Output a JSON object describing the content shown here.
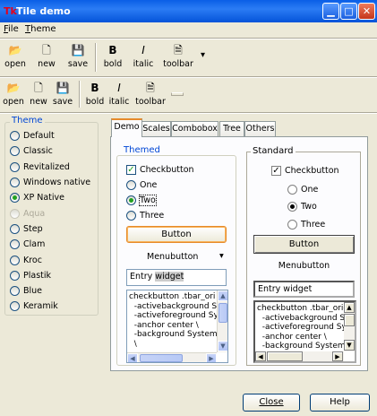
{
  "window": {
    "title": "Tile demo"
  },
  "menubar": [
    {
      "label": "File",
      "accel": "F",
      "rest": "ile"
    },
    {
      "label": "Theme",
      "accel": "T",
      "rest": "heme"
    }
  ],
  "toolbar1": {
    "buttons": [
      {
        "label": "open",
        "icon": "open-folder-icon"
      },
      {
        "label": "new",
        "icon": "new-file-icon"
      },
      {
        "label": "save",
        "icon": "save-icon"
      },
      {
        "label": "bold",
        "icon": "bold-icon",
        "glyph": "B"
      },
      {
        "label": "italic",
        "icon": "italic-icon",
        "glyph": "I"
      },
      {
        "label": "toolbar",
        "icon": "toolbar-icon"
      }
    ],
    "menu_glyph": "▾"
  },
  "toolbar2": {
    "buttons": [
      {
        "label": "open",
        "icon": "open-folder-icon"
      },
      {
        "label": "new",
        "icon": "new-file-icon"
      },
      {
        "label": "save",
        "icon": "save-icon"
      },
      {
        "label": "bold",
        "icon": "bold-icon",
        "glyph": "B"
      },
      {
        "label": "italic",
        "icon": "italic-icon",
        "glyph": "I"
      },
      {
        "label": "toolbar",
        "icon": "toolbar-icon"
      }
    ]
  },
  "theme_frame": {
    "label": "Theme",
    "options": [
      {
        "label": "Default",
        "selected": false,
        "disabled": false
      },
      {
        "label": "Classic",
        "selected": false,
        "disabled": false
      },
      {
        "label": "Revitalized",
        "selected": false,
        "disabled": false
      },
      {
        "label": "Windows native",
        "selected": false,
        "disabled": false
      },
      {
        "label": "XP Native",
        "selected": true,
        "disabled": false
      },
      {
        "label": "Aqua",
        "selected": false,
        "disabled": true
      },
      {
        "label": "Step",
        "selected": false,
        "disabled": false
      },
      {
        "label": "Clam",
        "selected": false,
        "disabled": false
      },
      {
        "label": "Kroc",
        "selected": false,
        "disabled": false
      },
      {
        "label": "Plastik",
        "selected": false,
        "disabled": false
      },
      {
        "label": "Blue",
        "selected": false,
        "disabled": false
      },
      {
        "label": "Keramik",
        "selected": false,
        "disabled": false
      }
    ]
  },
  "notebook": {
    "tabs": [
      "Demo",
      "Scales",
      "Combobox",
      "Tree",
      "Others"
    ],
    "active_tab": "Demo"
  },
  "themed": {
    "label": "Themed",
    "checkbutton": "Checkbutton",
    "checked": true,
    "radios": [
      "One",
      "Two",
      "Three"
    ],
    "selected_radio": "Two",
    "button": "Button",
    "menubutton": "Menubutton",
    "entry_value_pre": "Entry ",
    "entry_value_sel": "widget",
    "text_lines": [
      "checkbutton .tbar_ori",
      "  -activebackground S",
      "  -activeforeground Sy",
      "  -anchor center \\",
      "  -background System",
      "  \\"
    ]
  },
  "standard": {
    "label": "Standard",
    "checkbutton": "Checkbutton",
    "checked": true,
    "radios": [
      "One",
      "Two",
      "Three"
    ],
    "selected_radio": "Two",
    "button": "Button",
    "menubutton": "Menubutton",
    "entry_value": "Entry widget",
    "text_lines": [
      "checkbutton .tbar_orig",
      "  -activebackground S",
      "  -activeforeground Sy",
      "  -anchor center \\",
      "  -background System"
    ]
  },
  "footer": {
    "close": "Close",
    "help": "Help"
  },
  "colors": {
    "titlebar": "#0a5fe6",
    "window_bg": "#ece9d8",
    "tab_active_accent": "#e68b2c",
    "radio_selected": "#21a121"
  }
}
